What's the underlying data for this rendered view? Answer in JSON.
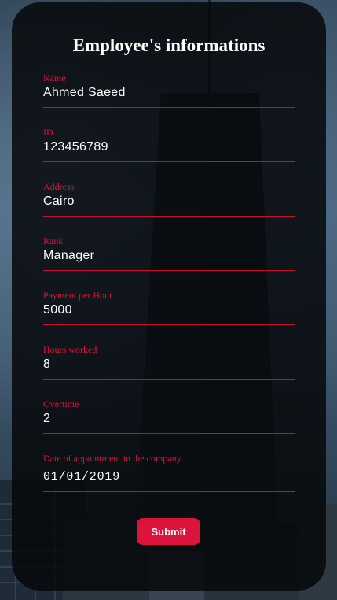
{
  "form": {
    "title": "Employee's informations",
    "fields": [
      {
        "label": "Name",
        "value": "Ahmed Saeed"
      },
      {
        "label": "ID",
        "value": "123456789"
      },
      {
        "label": "Address",
        "value": "Cairo"
      },
      {
        "label": "Rank",
        "value": "Manager"
      },
      {
        "label": "Payment per Hour",
        "value": "5000"
      },
      {
        "label": "Hours worked",
        "value": "8"
      },
      {
        "label": "Overtime",
        "value": "2"
      },
      {
        "label": "Date of appointment in the company",
        "value": "01/01/2019"
      }
    ],
    "submit_label": "Submit"
  },
  "colors": {
    "accent": "#dc143c",
    "card_background": "#06080b",
    "text": "#ffffff"
  }
}
